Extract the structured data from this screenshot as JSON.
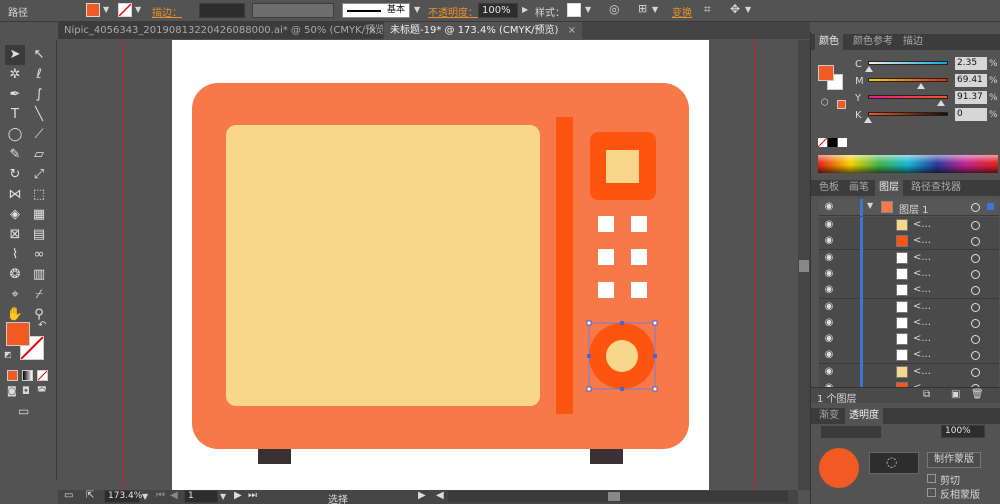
{
  "control_bar": {
    "object_label": "路径",
    "stroke_label": "描边：",
    "stroke_style_label": "基本",
    "opacity_label": "不透明度：",
    "opacity_value": "100%",
    "style_label": "样式：",
    "transform_label": "变换",
    "fill_color": "#f15a22"
  },
  "tabs": [
    {
      "label": "Nipic_4056343_20190813220426088000.ai* @ 50% (CMYK/预览)",
      "close": "×"
    },
    {
      "label": "未标题-19* @ 173.4% (CMYK/预览)",
      "close": "×"
    }
  ],
  "tools": {
    "fill_color": "#f15a22"
  },
  "artwork": {
    "body_color": "#f7794a",
    "window_color": "#f8d78c",
    "accent_color": "#fd5410",
    "foot_color": "#3a3135",
    "white": "#ffffff"
  },
  "color_panel": {
    "tabs": [
      "颜色",
      "颜色参考",
      "描边"
    ],
    "channels": [
      {
        "name": "C",
        "value": "2.35",
        "unit": "%"
      },
      {
        "name": "M",
        "value": "69.41",
        "unit": "%"
      },
      {
        "name": "Y",
        "value": "91.37",
        "unit": "%"
      },
      {
        "name": "K",
        "value": "0",
        "unit": "%"
      }
    ]
  },
  "layers_panel": {
    "tabs": [
      "色板",
      "画笔",
      "图层",
      "路径查找器"
    ],
    "layer_name": "图层 1",
    "sublayer_label": "<...",
    "sublayer_thumbs": [
      "#f8d78c",
      "#fd5410",
      "#ffffff",
      "#ffffff",
      "#ffffff",
      "#ffffff",
      "#ffffff",
      "#ffffff",
      "#ffffff",
      "#f8d78c",
      "#fd5410"
    ],
    "footer_label": "1 个图层"
  },
  "bottom_panel": {
    "tabs": [
      "渐变",
      "透明度"
    ],
    "opacity_value": "100%",
    "make_mask_button": "制作蒙版",
    "clip_label": "剪切",
    "invert_mask_label": "反相蒙版"
  },
  "status_bar": {
    "zoom": "173.4%",
    "page": "1",
    "tool_name": "选择"
  }
}
